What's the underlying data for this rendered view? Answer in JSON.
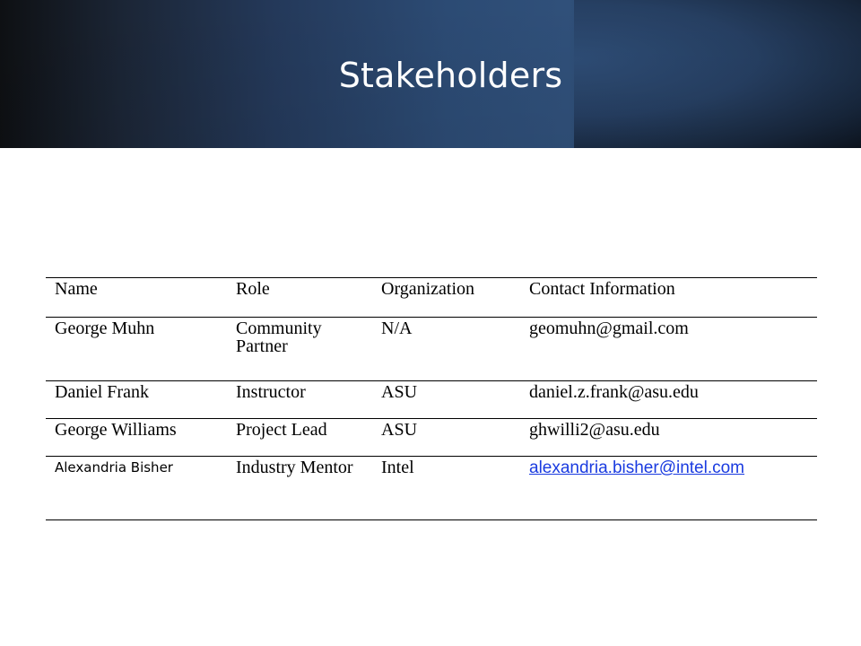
{
  "slide": {
    "title": "Stakeholders"
  },
  "table": {
    "headers": [
      "Name",
      "Role",
      "Organization",
      "Contact Information"
    ],
    "rows": [
      {
        "name": "George Muhn",
        "role": "Community Partner",
        "organization": "N/A",
        "contact": "geomuhn@gmail.com"
      },
      {
        "name": "Daniel Frank",
        "role": "Instructor",
        "organization": "ASU",
        "contact": "daniel.z.frank@asu.edu"
      },
      {
        "name": "George Williams",
        "role": "Project Lead",
        "organization": "ASU",
        "contact": "ghwilli2@asu.edu"
      },
      {
        "name": "Alexandria Bisher",
        "role": "Industry Mentor",
        "organization": "Intel",
        "contact": "alexandria.bisher@intel.com"
      }
    ]
  },
  "colors": {
    "header_band": "#2c4b74",
    "title_text": "#ffffff",
    "link": "#1a3be0"
  }
}
